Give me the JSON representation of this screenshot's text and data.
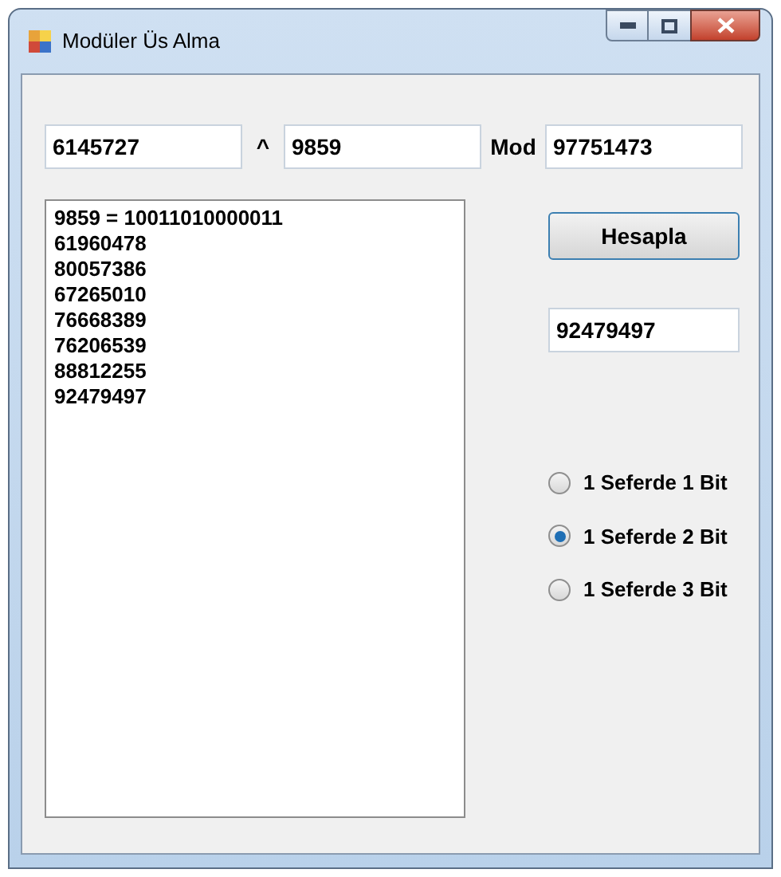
{
  "window": {
    "title": "Modüler Üs Alma"
  },
  "inputs": {
    "base": "6145727",
    "caret": "^",
    "exponent": "9859",
    "mod_label": "Mod",
    "modulus": "97751473"
  },
  "output_list": [
    "9859 = 10011010000011",
    "61960478",
    "80057386",
    "67265010",
    "76668389",
    "76206539",
    "88812255",
    "92479497"
  ],
  "compute_button": "Hesapla",
  "result": "92479497",
  "radios": [
    {
      "label": "1 Seferde 1 Bit",
      "selected": false
    },
    {
      "label": "1 Seferde 2 Bit",
      "selected": true
    },
    {
      "label": "1 Seferde 3 Bit",
      "selected": false
    }
  ]
}
